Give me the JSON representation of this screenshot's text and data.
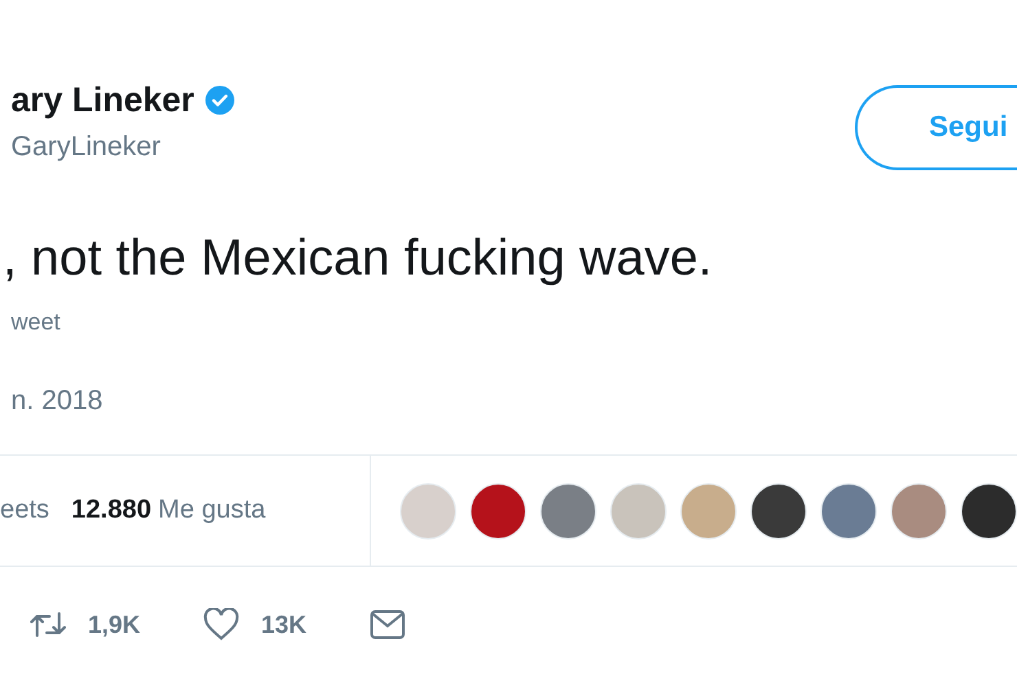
{
  "author": {
    "name": "ary Lineker",
    "verified": true,
    "handle": "GaryLineker"
  },
  "follow_button": {
    "label": "Segui"
  },
  "tweet_text": ", not the Mexican fucking wave.",
  "translate_link": "weet",
  "date": "n. 2018",
  "stats": [
    {
      "label": "eets"
    },
    {
      "count": "12.880",
      "label": "Me gusta"
    }
  ],
  "liked_by_avatars": [
    {
      "kind": "photo"
    },
    {
      "kind": "photo"
    },
    {
      "kind": "photo"
    },
    {
      "kind": "photo"
    },
    {
      "kind": "photo"
    },
    {
      "kind": "photo"
    },
    {
      "kind": "photo"
    },
    {
      "kind": "photo"
    },
    {
      "kind": "photo"
    }
  ],
  "actions": [
    {
      "kind": "retweet",
      "count": "1,9K"
    },
    {
      "kind": "like",
      "count": "13K"
    },
    {
      "kind": "message"
    }
  ]
}
